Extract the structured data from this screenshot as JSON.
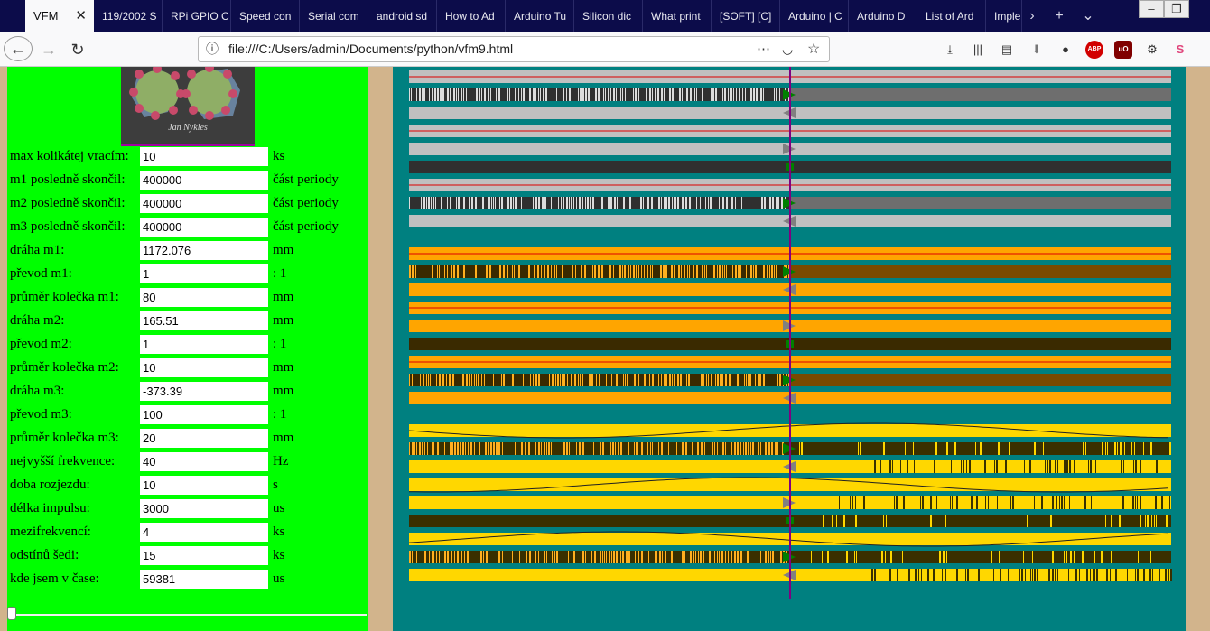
{
  "browser": {
    "tabs": [
      {
        "label": "VFM",
        "active": true
      },
      {
        "label": "119/2002 S"
      },
      {
        "label": "RPi GPIO C"
      },
      {
        "label": "Speed con"
      },
      {
        "label": "Serial com"
      },
      {
        "label": "android sd"
      },
      {
        "label": "How to Ad"
      },
      {
        "label": "Arduino Tu"
      },
      {
        "label": "Silicon dic"
      },
      {
        "label": "What print"
      },
      {
        "label": "[SOFT] [C]"
      },
      {
        "label": "Arduino | C"
      },
      {
        "label": "Arduino D"
      },
      {
        "label": "List of Ard"
      },
      {
        "label": "Imple"
      }
    ],
    "url": "file:///C:/Users/admin/Documents/python/vfm9.html",
    "icons": {
      "more": "⋯",
      "pocket": "◡",
      "star": "☆",
      "abp": "ABP",
      "ublock": "uO"
    }
  },
  "logo": {
    "caption": "Jan Nykles"
  },
  "form": {
    "rows": [
      {
        "label": "max kolikátej vracím:",
        "value": "10",
        "unit": "ks"
      },
      {
        "label": "m1 posledně skončil:",
        "value": "400000",
        "unit": "část periody"
      },
      {
        "label": "m2 posledně skončil:",
        "value": "400000",
        "unit": "část periody"
      },
      {
        "label": "m3 posledně skončil:",
        "value": "400000",
        "unit": "část periody"
      },
      {
        "label": "dráha m1:",
        "value": "1172.076",
        "unit": "mm"
      },
      {
        "label": "převod m1:",
        "value": "1",
        "unit": ": 1"
      },
      {
        "label": "průměr kolečka m1:",
        "value": "80",
        "unit": "mm"
      },
      {
        "label": "dráha m2:",
        "value": "165.51",
        "unit": "mm"
      },
      {
        "label": "převod m2:",
        "value": "1",
        "unit": ": 1"
      },
      {
        "label": "průměr kolečka m2:",
        "value": "10",
        "unit": "mm"
      },
      {
        "label": "dráha m3:",
        "value": "-373.39",
        "unit": "mm"
      },
      {
        "label": "převod m3:",
        "value": "100",
        "unit": ": 1"
      },
      {
        "label": "průměr kolečka m3:",
        "value": "20",
        "unit": "mm"
      },
      {
        "label": "nejvyšší frekvence:",
        "value": "40",
        "unit": "Hz"
      },
      {
        "label": "doba rozjezdu:",
        "value": "10",
        "unit": "s"
      },
      {
        "label": "délka impulsu:",
        "value": "3000",
        "unit": "us"
      },
      {
        "label": "mezifrekvencí:",
        "value": "4",
        "unit": "ks"
      },
      {
        "label": "odstínů šedi:",
        "value": "15",
        "unit": "ks"
      },
      {
        "label": "kde jsem v čase:",
        "value": "59381",
        "unit": "us"
      }
    ]
  },
  "slider": {
    "value": 0
  },
  "visualization": {
    "colors": {
      "background": "#008080",
      "cursor": "#800080",
      "play_marker": "#008000",
      "back_marker": "#808080",
      "sine": "#222222",
      "ref_line": "#dd0000"
    },
    "groups": [
      {
        "name": "m1",
        "light": "#c0c0c0",
        "dark": "#303030",
        "mid": "#6e6e6e"
      },
      {
        "name": "m2",
        "light": "#ffa500",
        "dark": "#3a2a00",
        "mid": "#7a4a00"
      },
      {
        "name": "m3",
        "light": "#ffd700",
        "dark": "#3a3000",
        "mid": "#7a6000"
      }
    ]
  }
}
